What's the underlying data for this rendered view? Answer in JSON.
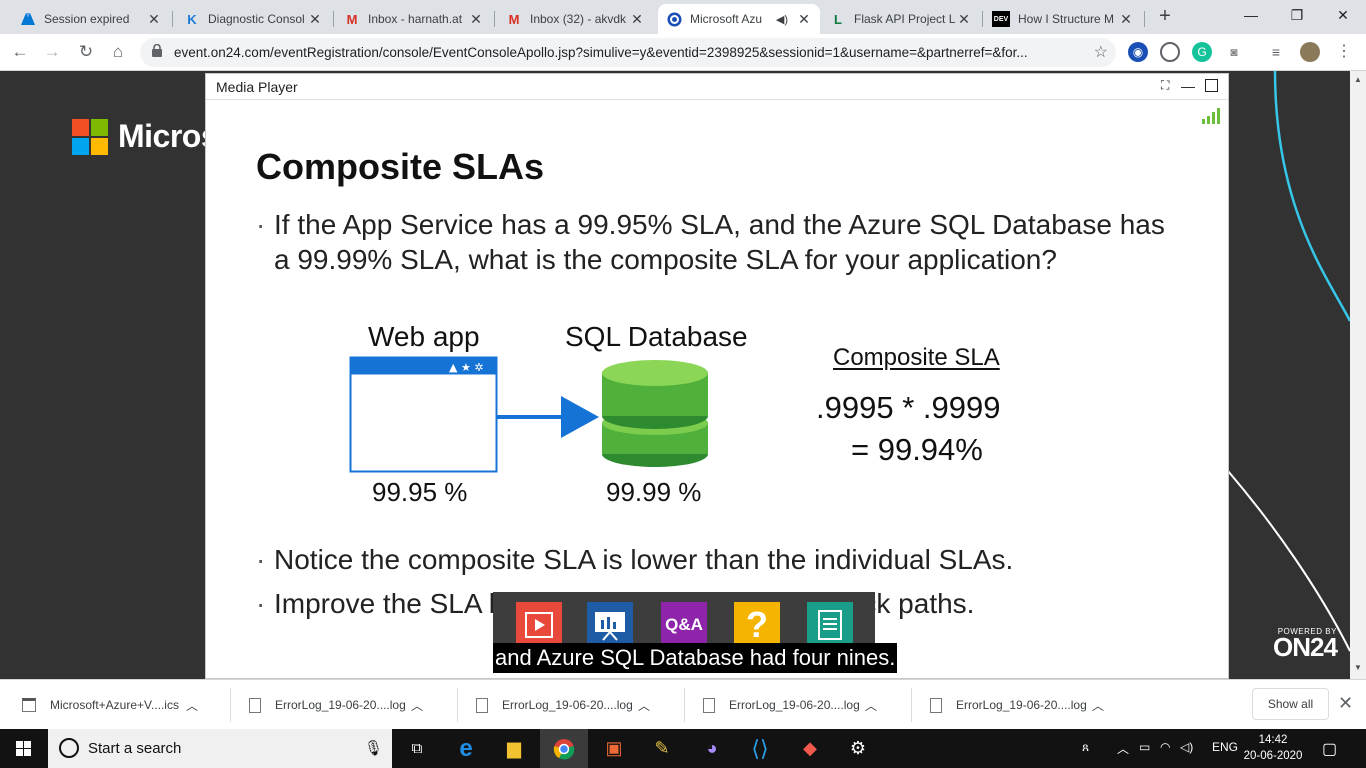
{
  "tabs": [
    {
      "title": "Session expired",
      "icon": "azure-icon",
      "active": false
    },
    {
      "title": "Diagnostic Consol",
      "icon": "kudu-icon",
      "active": false
    },
    {
      "title": "Inbox - harnath.at",
      "icon": "gmail-icon",
      "active": false
    },
    {
      "title": "Inbox (32) - akvdk",
      "icon": "gmail-icon",
      "active": false
    },
    {
      "title": "Microsoft Azu",
      "icon": "on24-icon",
      "active": true
    },
    {
      "title": "Flask API Project L",
      "icon": "flask-icon",
      "active": false
    },
    {
      "title": "How I Structure M",
      "icon": "dev-icon",
      "active": false
    }
  ],
  "newtab_glyph": "+",
  "window": {
    "minimize": "—",
    "maximize": "❐",
    "close": "✕"
  },
  "toolbar": {
    "url": "event.on24.com/eventRegistration/console/EventConsoleApollo.jsp?simulive=y&eventid=2398925&sessionid=1&username=&partnerref=&for..."
  },
  "page": {
    "brand_text": "Micros"
  },
  "player": {
    "title": "Media Player"
  },
  "slide": {
    "title": "Composite SLAs",
    "bullet1_line1": "If the App Service has a 99.95% SLA, and the Azure SQL Database has",
    "bullet1_line2": "a 99.99% SLA, what is the composite SLA for your application?",
    "webapp_label": "Web app",
    "sql_label": "SQL Database",
    "webapp_pct": "99.95 %",
    "sql_pct": "99.99 %",
    "composite_title": "Composite SLA",
    "formula_line1": ".9995 * .9999",
    "formula_line2": "= 99.94%",
    "bullet2": "Notice the composite SLA is lower than the individual SLAs.",
    "bullet3": "Improve the SLA by creating independent fallback paths."
  },
  "widgets": [
    {
      "name": "media-widget-icon",
      "label": "",
      "color": "#e8493a"
    },
    {
      "name": "slides-widget-icon",
      "label": "",
      "color": "#1f5ca6"
    },
    {
      "name": "qa-widget",
      "label": "Q&A",
      "color": "#8e24aa"
    },
    {
      "name": "help-widget",
      "label": "?",
      "color": "#f5b400"
    },
    {
      "name": "resources-widget-icon",
      "label": "",
      "color": "#1a9e8a"
    }
  ],
  "caption": "and Azure SQL Database had four nines.",
  "on24": {
    "powered_by": "POWERED BY",
    "logo": "ON24"
  },
  "downloads": [
    {
      "name": "Microsoft+Azure+V....ics"
    },
    {
      "name": "ErrorLog_19-06-20....log"
    },
    {
      "name": "ErrorLog_19-06-20....log"
    },
    {
      "name": "ErrorLog_19-06-20....log"
    },
    {
      "name": "ErrorLog_19-06-20....log"
    }
  ],
  "show_all": "Show all",
  "taskbar": {
    "search_placeholder": "Start a search",
    "lang": "ENG",
    "time": "14:42",
    "date": "20-06-2020"
  }
}
